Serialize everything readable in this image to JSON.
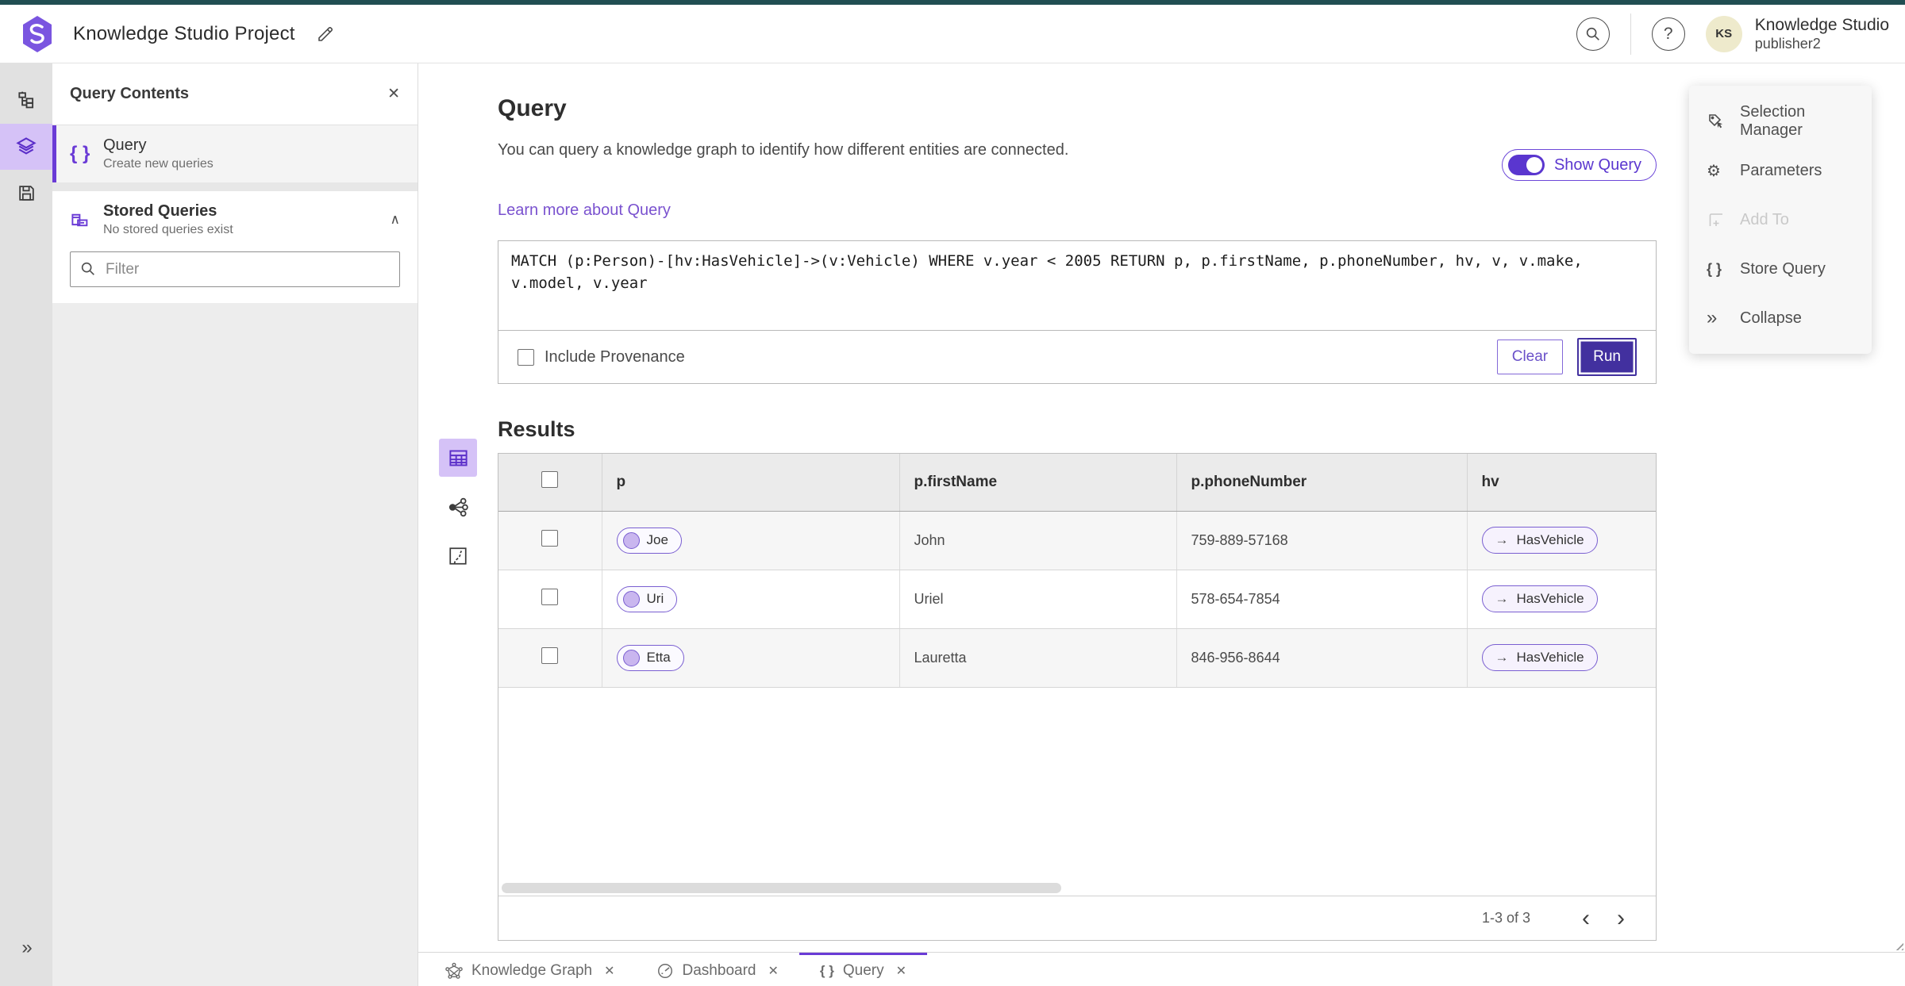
{
  "header": {
    "app_title": "Knowledge Studio Project",
    "user": {
      "initials": "KS",
      "name": "Knowledge Studio",
      "role": "publisher2"
    }
  },
  "panel": {
    "title": "Query Contents",
    "query_item": {
      "title": "Query",
      "subtitle": "Create new queries"
    },
    "stored": {
      "title": "Stored Queries",
      "subtitle": "No stored queries exist"
    },
    "filter_placeholder": "Filter"
  },
  "query": {
    "title": "Query",
    "description": "You can query a knowledge graph to identify how different entities are connected.",
    "link_label": "Learn more about Query",
    "toggle_label": "Show Query",
    "text": "MATCH (p:Person)-[hv:HasVehicle]->(v:Vehicle) WHERE v.year < 2005 RETURN p, p.firstName, p.phoneNumber, hv, v, v.make, v.model, v.year",
    "provenance_label": "Include Provenance",
    "clear_label": "Clear",
    "run_label": "Run"
  },
  "results": {
    "title": "Results",
    "columns": [
      "p",
      "p.firstName",
      "p.phoneNumber",
      "hv"
    ],
    "rows": [
      {
        "p": "Joe",
        "firstName": "John",
        "phone": "759-889-57168",
        "hv": "HasVehicle"
      },
      {
        "p": "Uri",
        "firstName": "Uriel",
        "phone": "578-654-7854",
        "hv": "HasVehicle"
      },
      {
        "p": "Etta",
        "firstName": "Lauretta",
        "phone": "846-956-8644",
        "hv": "HasVehicle"
      }
    ],
    "pagination_label": "1-3 of 3"
  },
  "right_panel": {
    "items": [
      "Selection Manager",
      "Parameters",
      "Add To",
      "Store Query",
      "Collapse"
    ]
  },
  "tabs": [
    {
      "label": "Knowledge Graph"
    },
    {
      "label": "Dashboard"
    },
    {
      "label": "Query"
    }
  ],
  "icons": {
    "close": "✕",
    "question": "?",
    "chevron_up": "∧",
    "chevron_left": "‹",
    "chevron_right": "›",
    "collapse": "»",
    "expand": "»",
    "braces": "{ }",
    "gear": "⚙",
    "arrow_right": "→"
  },
  "colors": {
    "accent": "#6a3bd6",
    "accent_dark": "#42309f",
    "top_strip": "#214e52",
    "selected_bg": "#d5c2f7",
    "avatar_bg": "#eeeacc"
  }
}
